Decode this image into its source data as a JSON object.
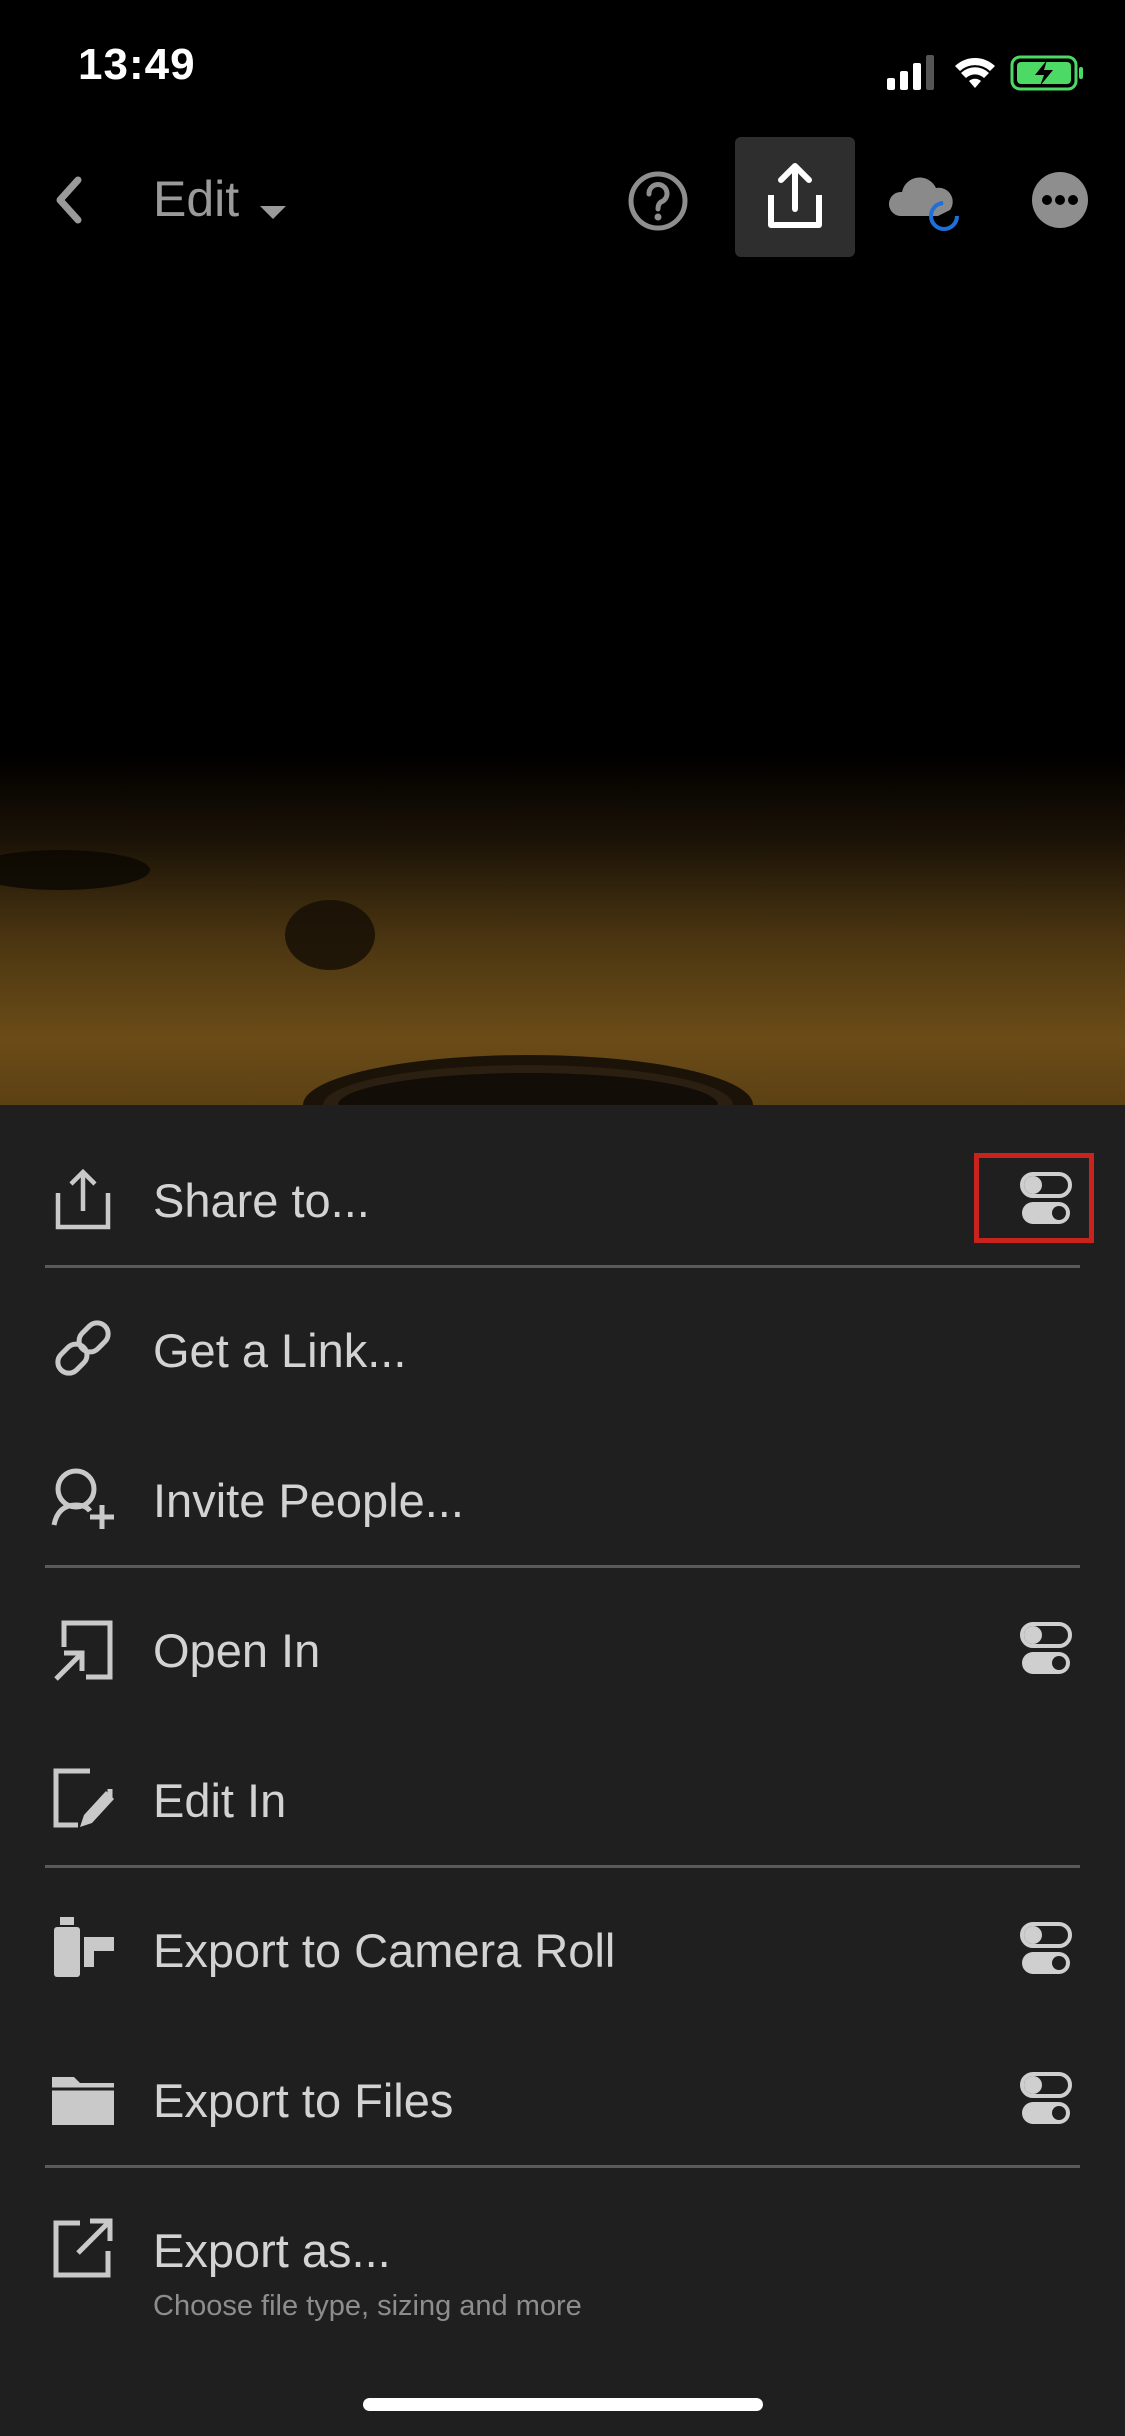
{
  "status_bar": {
    "time": "13:49"
  },
  "nav": {
    "back_icon": "chevron-left-icon",
    "mode_label": "Edit",
    "help_icon": "question-icon",
    "share_icon": "share-icon",
    "cloud_icon": "cloud-sync-icon",
    "more_icon": "more-icon"
  },
  "menu": {
    "items": [
      {
        "label": "Share to...",
        "icon": "share-icon",
        "has_toggle": true
      },
      {
        "label": "Get a Link...",
        "icon": "link-icon",
        "has_toggle": false
      },
      {
        "label": "Invite People...",
        "icon": "invite-person-icon",
        "has_toggle": false
      },
      {
        "label": "Open In",
        "icon": "open-in-icon",
        "has_toggle": true
      },
      {
        "label": "Edit In",
        "icon": "edit-in-icon",
        "has_toggle": false
      },
      {
        "label": "Export to Camera Roll",
        "icon": "camera-roll-icon",
        "has_toggle": true
      },
      {
        "label": "Export to Files",
        "icon": "folder-icon",
        "has_toggle": true
      },
      {
        "label": "Export as...",
        "sublabel": "Choose file type, sizing and more",
        "icon": "export-icon",
        "has_toggle": false
      }
    ]
  },
  "colors": {
    "accent_highlight": "#c8231c",
    "battery": "#4cd964",
    "sync": "#1e6fd9"
  }
}
